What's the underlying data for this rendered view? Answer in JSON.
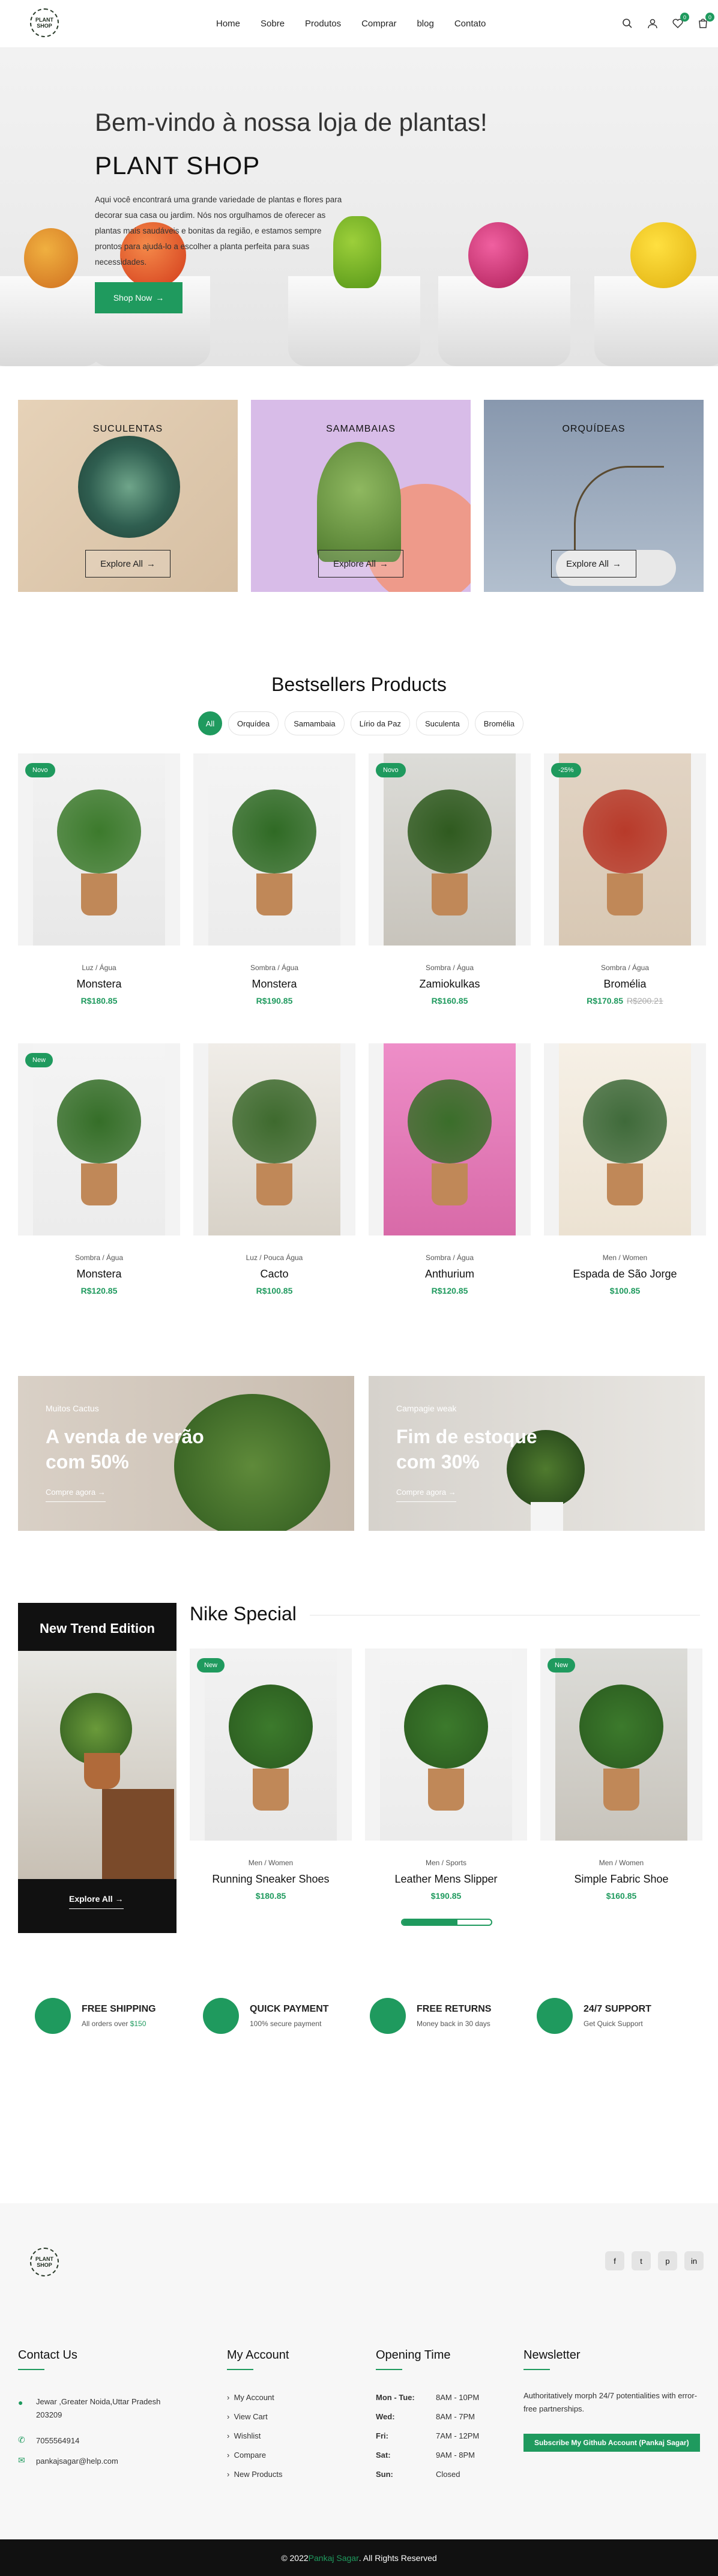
{
  "header": {
    "logo_text": "PLANT SHOP",
    "nav": [
      "Home",
      "Sobre",
      "Produtos",
      "Comprar",
      "blog",
      "Contato"
    ],
    "wishlist_count": "0",
    "cart_count": "0"
  },
  "hero": {
    "title": "Bem-vindo à nossa loja de plantas!",
    "subtitle": "PLANT SHOP",
    "text": "Aqui você encontrará uma grande variedade de plantas e flores para decorar sua casa ou jardim. Nós nos orgulhamos de oferecer as plantas mais saudáveis e bonitas da região, e estamos sempre prontos para ajudá-lo a escolher a planta perfeita para suas necessidades.",
    "button": "Shop Now"
  },
  "categories": [
    {
      "title": "SUCULENTAS",
      "button": "Explore All"
    },
    {
      "title": "SAMAMBAIAS",
      "button": "Explore All"
    },
    {
      "title": "ORQUÍDEAS",
      "button": "Explore All"
    }
  ],
  "bestsellers": {
    "title": "Bestsellers Products",
    "filters": [
      "All",
      "Orquídea",
      "Samambaia",
      "Lírio da Paz",
      "Suculenta",
      "Bromélia"
    ],
    "products": [
      {
        "tag": "Novo",
        "category": "Luz / Água",
        "name": "Monstera",
        "price": "R$180.85",
        "old": ""
      },
      {
        "tag": "",
        "category": "Sombra / Água",
        "name": "Monstera",
        "price": "R$190.85",
        "old": ""
      },
      {
        "tag": "Novo",
        "category": "Sombra / Água",
        "name": "Zamiokulkas",
        "price": "R$160.85",
        "old": ""
      },
      {
        "tag": "-25%",
        "category": "Sombra / Água",
        "name": "Bromélia",
        "price": "R$170.85",
        "old": "R$200.21"
      },
      {
        "tag": "New",
        "category": "Sombra / Água",
        "name": "Monstera",
        "price": "R$120.85",
        "old": ""
      },
      {
        "tag": "",
        "category": "Luz / Pouca Água",
        "name": "Cacto",
        "price": "R$100.85",
        "old": ""
      },
      {
        "tag": "",
        "category": "Sombra / Água",
        "name": "Anthurium",
        "price": "R$120.85",
        "old": ""
      },
      {
        "tag": "",
        "category": "Men / Women",
        "name": "Espada de São Jorge",
        "price": "$100.85",
        "old": ""
      }
    ]
  },
  "banners": [
    {
      "sub": "Muitos Cactus",
      "title": "A venda de verão com 50%",
      "link": "Compre agora"
    },
    {
      "sub": "Campagie weak",
      "title": "Fim de estoque com 30%",
      "link": "Compre agora"
    }
  ],
  "nike": {
    "trend_title": "New Trend Edition",
    "trend_button": "Explore All",
    "title": "Nike Special",
    "products": [
      {
        "tag": "New",
        "category": "Men / Women",
        "name": "Running Sneaker Shoes",
        "price": "$180.85"
      },
      {
        "tag": "",
        "category": "Men / Sports",
        "name": "Leather Mens Slipper",
        "price": "$190.85",
        "progress": 0.62
      },
      {
        "tag": "New",
        "category": "Men / Women",
        "name": "Simple Fabric Shoe",
        "price": "$160.85"
      }
    ]
  },
  "features": [
    {
      "title": "FREE SHIPPING",
      "sub_prefix": "All orders over ",
      "sub_accent": "$150"
    },
    {
      "title": "QUICK PAYMENT",
      "sub_prefix": "100% secure payment",
      "sub_accent": ""
    },
    {
      "title": "FREE RETURNS",
      "sub_prefix": "Money back in 30 days",
      "sub_accent": ""
    },
    {
      "title": "24/7 SUPPORT",
      "sub_prefix": "Get Quick Support",
      "sub_accent": ""
    }
  ],
  "footer": {
    "contact": {
      "title": "Contact Us",
      "address": "Jewar ,Greater Noida,Uttar Pradesh 203209",
      "phone": "7055564914",
      "email": "pankajsagar@help.com"
    },
    "account": {
      "title": "My Account",
      "links": [
        "My Account",
        "View Cart",
        "Wishlist",
        "Compare",
        "New Products"
      ]
    },
    "opening": {
      "title": "Opening Time",
      "rows": [
        [
          "Mon - Tue:",
          "8AM - 10PM"
        ],
        [
          "Wed:",
          "8AM - 7PM"
        ],
        [
          "Fri:",
          "7AM - 12PM"
        ],
        [
          "Sat:",
          "9AM - 8PM"
        ],
        [
          "Sun:",
          "Closed"
        ]
      ]
    },
    "newsletter": {
      "title": "Newsletter",
      "text": "Authoritatively morph 24/7 potentialities with error-free partnerships.",
      "button": "Subscribe My Github Account (Pankaj Sagar)"
    },
    "copyright_pre": "© 2022 ",
    "copyright_name": "Pankaj Sagar",
    "copyright_post": ". All Rights Reserved"
  },
  "colors": {
    "accent": "#1f9a5e",
    "dark": "#111111"
  }
}
